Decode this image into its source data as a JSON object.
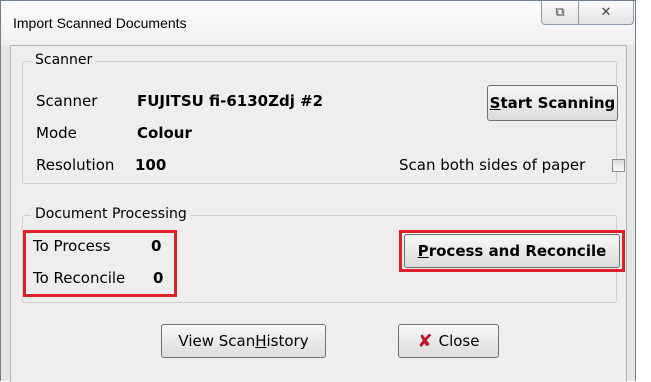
{
  "window": {
    "title": "Import Scanned Documents"
  },
  "titlebar_icons": {
    "restore": "restore-icon",
    "close": "close-icon"
  },
  "scanner_group": {
    "label": "Scanner",
    "scanner_label": "Scanner",
    "scanner_value": "FUJITSU fi-6130Zdj #2",
    "mode_label": "Mode",
    "mode_value": "Colour",
    "resolution_label": "Resolution",
    "resolution_value": "100",
    "start_button": {
      "pre": "",
      "mnemonic": "S",
      "post": "tart Scanning"
    },
    "both_sides_label": "Scan both sides of paper",
    "both_sides_checked": false
  },
  "processing_group": {
    "label": "Document Processing",
    "to_process_label": "To Process",
    "to_process_value": "0",
    "to_reconcile_label": "To Reconcile",
    "to_reconcile_value": "0",
    "process_button": {
      "pre": "",
      "mnemonic": "P",
      "post": "rocess and Reconcile"
    }
  },
  "footer": {
    "history_button": {
      "pre": "View Scan ",
      "mnemonic": "H",
      "post": "istory"
    },
    "close_button": {
      "label": "Close",
      "icon": "x-icon"
    }
  },
  "highlight_color": "#e0202a"
}
